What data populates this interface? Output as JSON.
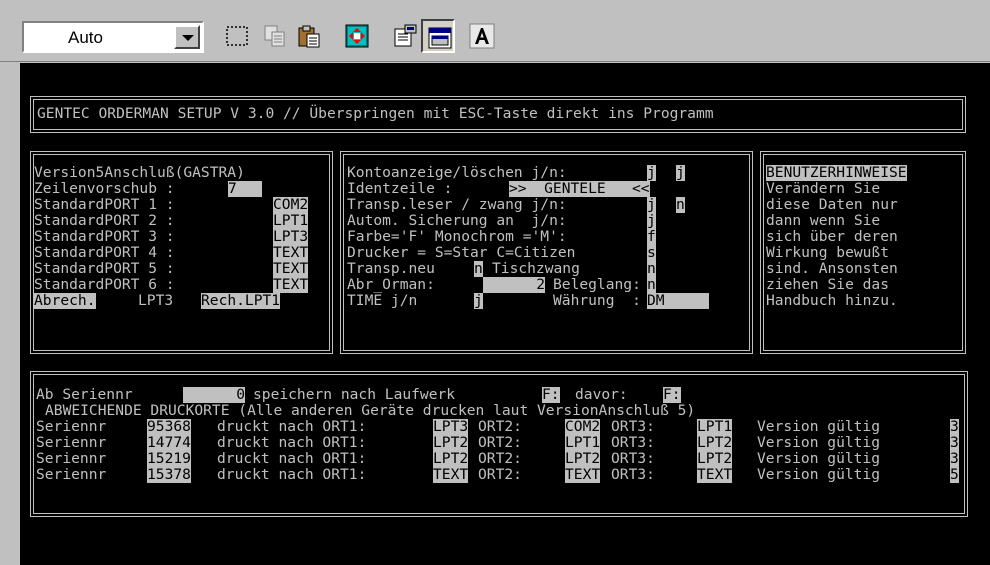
{
  "toolbar": {
    "font_size_value": "Auto",
    "icons": [
      "select-rect-icon",
      "copy-icon",
      "paste-icon",
      "full-screen-icon",
      "properties-icon",
      "background-icon",
      "font-icon"
    ]
  },
  "title": "GENTEC ORDERMAN SETUP V 3.0 // Überspringen mit ESC-Taste direkt ins Programm",
  "left_panel": {
    "header": "Version5Anschluß(GASTRA)",
    "zeilen_label": "Zeilenvorschub :",
    "zeilen_value": "7",
    "ports": [
      {
        "label": "StandardPORT 1 :",
        "value": "COM2"
      },
      {
        "label": "StandardPORT 2 :",
        "value": "LPT1"
      },
      {
        "label": "StandardPORT 3 :",
        "value": "LPT3"
      },
      {
        "label": "StandardPORT 4 :",
        "value": "TEXT"
      },
      {
        "label": "StandardPORT 5 :",
        "value": "TEXT"
      },
      {
        "label": "StandardPORT 6 :",
        "value": "TEXT"
      }
    ],
    "abrech_label": "Abrech.",
    "abrech_value": "LPT3",
    "rech_label": "Rech.LPT1"
  },
  "mid_panel": {
    "kontoanzeige_label": "Kontoanzeige/löschen j/n:",
    "kontoanzeige_v1": "j",
    "kontoanzeige_v2": "j",
    "identzeile_label": "Identzeile :",
    "identzeile_value": ">>  GENTELE   <<",
    "transp_label": "Transp.leser / zwang j/n:",
    "transp_v1": "j",
    "transp_v2": "n",
    "autom_label": "Autom. Sicherung an  j/n:",
    "autom_value": "j",
    "farbe_label": "Farbe='F' Monochrom ='M':",
    "farbe_value": "f",
    "drucker_label": "Drucker = S=Star C=Citizen",
    "drucker_value": "s",
    "transpneu_label": "Transp.neu",
    "transpneu_value": "n",
    "tischzwang_label": "Tischzwang",
    "tischzwang_value": "n",
    "abr_label": "Abr_Orman:",
    "abr_value": "2",
    "beleglang_label": "Beleglang:",
    "beleglang_value": "n",
    "time_label": "TIME j/n",
    "time_value": "j",
    "waehrung_label": "Währung  :",
    "waehrung_value": "DM"
  },
  "right_panel": {
    "title": "BENUTZERHINWEISE",
    "lines": [
      "Verändern Sie",
      "diese Daten nur",
      "dann wenn Sie",
      "sich über deren",
      "Wirkung bewußt",
      "sind. Ansonsten",
      "ziehen Sie das",
      "Handbuch hinzu."
    ]
  },
  "bottom_panel": {
    "ab_label": "Ab Seriennr",
    "ab_value": "0",
    "speichern_label": "speichern nach Laufwerk",
    "laufwerk_value": "F:",
    "davor_label": "davor:",
    "davor_value": "F:",
    "subtitle": "ABWEICHENDE DRUCKORTE (Alle anderen Geräte drucken laut VersionAnschluß 5)",
    "row_label": "Seriennr",
    "druckt_label": "druckt nach ORT1:",
    "ort2_label": "ORT2:",
    "ort3_label": "ORT3:",
    "version_label": "Version gültig",
    "rows": [
      {
        "serial": "95368",
        "ort1": "LPT3",
        "ort2": "COM2",
        "ort3": "LPT1",
        "version": "3"
      },
      {
        "serial": "14774",
        "ort1": "LPT2",
        "ort2": "LPT1",
        "ort3": "LPT2",
        "version": "3"
      },
      {
        "serial": "15219",
        "ort1": "LPT2",
        "ort2": "LPT2",
        "ort3": "LPT2",
        "version": "3"
      },
      {
        "serial": "15378",
        "ort1": "TEXT",
        "ort2": "TEXT",
        "ort3": "TEXT",
        "version": "5"
      }
    ]
  }
}
